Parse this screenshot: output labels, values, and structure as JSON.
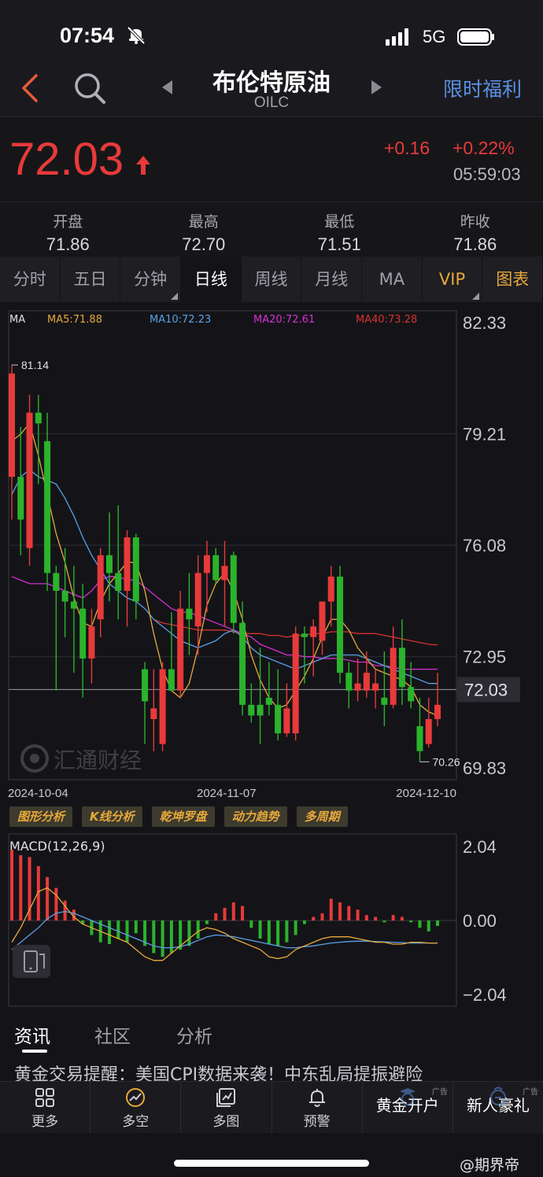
{
  "status": {
    "time": "07:54",
    "network": "5G"
  },
  "header": {
    "title": "布伦特原油",
    "code": "OILC",
    "promo": "限时福利"
  },
  "quote": {
    "price": "72.03",
    "change_abs": "+0.16",
    "change_pct": "+0.22%",
    "time": "05:59:03"
  },
  "stats": [
    {
      "label": "开盘",
      "value": "71.86"
    },
    {
      "label": "最高",
      "value": "72.70"
    },
    {
      "label": "最低",
      "value": "71.51"
    },
    {
      "label": "昨收",
      "value": "71.86"
    }
  ],
  "tabs": [
    "分时",
    "五日",
    "分钟",
    "日线",
    "周线",
    "月线",
    "MA",
    "VIP",
    "图表"
  ],
  "active_tab": "日线",
  "colors": {
    "up": "#e83a3a",
    "down": "#2bb32b",
    "ma5": "#e7a93a",
    "ma10": "#5aa0e6",
    "ma20": "#d62fd6",
    "ma40": "#d83030"
  },
  "chart_data": [
    {
      "type": "candlestick",
      "indicator": "MA",
      "legend": {
        "label": "MA",
        "ma5": "MA5:71.88",
        "ma10": "MA10:72.23",
        "ma20": "MA20:72.61",
        "ma40": "MA40:73.28"
      },
      "y_ticks": [
        "82.33",
        "79.21",
        "76.08",
        "72.95",
        "69.83"
      ],
      "ylim": [
        69.83,
        82.33
      ],
      "last_price_label": "72.03",
      "high_label": "81.14",
      "low_label": "70.26",
      "x_labels": [
        "2024-10-04",
        "2024-11-07",
        "2024-12-10"
      ],
      "candles": [
        [
          78.0,
          81.14,
          76.8,
          80.9
        ],
        [
          78.0,
          79.4,
          75.8,
          76.8
        ],
        [
          76.0,
          80.3,
          75.5,
          79.8
        ],
        [
          79.8,
          80.3,
          77.8,
          79.5
        ],
        [
          79.0,
          79.8,
          74.8,
          75.3
        ],
        [
          75.3,
          75.5,
          72.0,
          74.8
        ],
        [
          74.8,
          76.0,
          73.5,
          74.5
        ],
        [
          74.5,
          75.5,
          72.5,
          74.3
        ],
        [
          74.3,
          75.0,
          71.8,
          72.9
        ],
        [
          72.9,
          74.3,
          72.2,
          73.8
        ],
        [
          74.0,
          76.0,
          73.5,
          75.8
        ],
        [
          75.8,
          77.0,
          74.5,
          75.3
        ],
        [
          75.3,
          77.2,
          74.0,
          74.8
        ],
        [
          74.8,
          76.5,
          73.8,
          76.3
        ],
        [
          76.3,
          76.4,
          74.0,
          74.5
        ],
        [
          72.6,
          72.8,
          70.5,
          71.7
        ],
        [
          71.2,
          72.6,
          70.3,
          71.5
        ],
        [
          70.5,
          72.8,
          70.3,
          72.6
        ],
        [
          72.6,
          74.2,
          72.2,
          72.0
        ],
        [
          72.0,
          74.8,
          71.8,
          74.3
        ],
        [
          74.3,
          75.3,
          73.0,
          74.0
        ],
        [
          73.8,
          75.8,
          73.0,
          75.3
        ],
        [
          75.3,
          76.2,
          74.2,
          75.8
        ],
        [
          75.8,
          76.0,
          75.0,
          75.1
        ],
        [
          75.1,
          76.2,
          73.8,
          75.5
        ],
        [
          75.8,
          75.9,
          73.6,
          73.9
        ],
        [
          73.9,
          74.5,
          71.3,
          71.6
        ],
        [
          71.6,
          72.2,
          71.1,
          71.3
        ],
        [
          71.6,
          73.2,
          70.5,
          71.3
        ],
        [
          71.8,
          72.8,
          71.3,
          71.6
        ],
        [
          71.6,
          72.6,
          70.6,
          70.8
        ],
        [
          70.8,
          72.2,
          70.7,
          71.5
        ],
        [
          70.8,
          73.8,
          70.6,
          73.6
        ],
        [
          73.6,
          73.8,
          72.2,
          73.5
        ],
        [
          73.5,
          74.0,
          72.4,
          73.8
        ],
        [
          73.4,
          74.5,
          73.0,
          74.5
        ],
        [
          74.5,
          75.5,
          73.8,
          75.2
        ],
        [
          75.2,
          75.5,
          72.2,
          72.5
        ],
        [
          72.5,
          72.8,
          71.5,
          72.0
        ],
        [
          72.0,
          72.9,
          71.7,
          72.2
        ],
        [
          72.0,
          73.1,
          71.8,
          72.5
        ],
        [
          72.0,
          72.6,
          71.5,
          72.2
        ],
        [
          71.8,
          73.1,
          71.0,
          71.6
        ],
        [
          71.6,
          73.8,
          71.5,
          73.2
        ],
        [
          73.2,
          74.0,
          71.6,
          72.1
        ],
        [
          72.1,
          72.8,
          71.5,
          71.7
        ],
        [
          71.0,
          71.8,
          70.0,
          70.3
        ],
        [
          70.5,
          71.8,
          70.4,
          71.2
        ],
        [
          71.2,
          72.5,
          71.0,
          71.6
        ]
      ],
      "ma5": [
        79.0,
        79.2,
        79.5,
        78.6,
        77.5,
        76.4,
        75.6,
        74.6,
        73.9,
        73.8,
        74.5,
        75.0,
        75.3,
        75.6,
        75.6,
        74.8,
        73.6,
        72.6,
        72.0,
        71.8,
        72.2,
        73.2,
        74.4,
        75.0,
        75.3,
        74.8,
        74.0,
        73.0,
        72.3,
        71.8,
        71.5,
        71.6,
        72.0,
        72.4,
        72.9,
        73.5,
        74.0,
        74.0,
        73.7,
        73.2,
        72.9,
        72.6,
        72.5,
        72.4,
        72.3,
        72.1,
        71.6,
        71.4,
        71.3
      ],
      "ma10": [
        77.5,
        78.0,
        78.2,
        78.0,
        77.9,
        77.8,
        77.4,
        76.9,
        76.3,
        75.8,
        75.4,
        75.0,
        74.8,
        74.6,
        74.5,
        74.3,
        74.0,
        73.8,
        73.6,
        73.4,
        73.3,
        73.2,
        73.3,
        73.4,
        73.6,
        73.7,
        73.5,
        73.2,
        73.0,
        72.9,
        72.8,
        72.7,
        72.6,
        72.7,
        72.8,
        72.9,
        73.0,
        73.0,
        73.0,
        73.0,
        72.9,
        72.8,
        72.7,
        72.6,
        72.5,
        72.4,
        72.3,
        72.2,
        72.2
      ],
      "ma20": [
        75.2,
        75.1,
        75.0,
        75.0,
        75.0,
        74.9,
        74.8,
        74.7,
        74.6,
        74.8,
        75.1,
        75.2,
        75.2,
        75.1,
        75.1,
        74.9,
        74.7,
        74.5,
        74.3,
        74.2,
        74.2,
        74.1,
        74.0,
        73.9,
        73.8,
        73.7,
        73.6,
        73.5,
        73.3,
        73.2,
        73.1,
        73.0,
        73.0,
        72.95,
        72.95,
        72.9,
        72.9,
        72.9,
        72.85,
        72.8,
        72.8,
        72.7,
        72.7,
        72.65,
        72.6,
        72.6,
        72.6,
        72.6,
        72.6
      ],
      "ma40": [
        null,
        null,
        null,
        null,
        null,
        null,
        null,
        null,
        null,
        null,
        null,
        null,
        null,
        null,
        null,
        null,
        74.0,
        73.9,
        73.85,
        73.8,
        73.75,
        73.7,
        73.7,
        73.7,
        73.7,
        73.65,
        73.6,
        73.6,
        73.6,
        73.55,
        73.55,
        73.5,
        73.55,
        73.55,
        73.6,
        73.6,
        73.65,
        73.65,
        73.65,
        73.6,
        73.6,
        73.6,
        73.55,
        73.5,
        73.45,
        73.4,
        73.35,
        73.3,
        73.28
      ]
    },
    {
      "type": "bar",
      "indicator": "MACD",
      "title": "MACD(12,26,9)",
      "y_ticks": [
        "2.04",
        "0.00",
        "−2.04"
      ],
      "ylim": [
        -2.04,
        2.04
      ],
      "histogram": [
        1.95,
        1.8,
        1.75,
        1.5,
        1.2,
        0.9,
        0.55,
        0.3,
        -0.1,
        -0.4,
        -0.6,
        -0.65,
        -0.5,
        -0.6,
        -0.35,
        -0.7,
        -0.9,
        -1.0,
        -0.9,
        -0.8,
        -0.7,
        -0.5,
        -0.1,
        0.2,
        0.35,
        0.5,
        0.4,
        -0.2,
        -0.5,
        -0.65,
        -0.7,
        -0.6,
        -0.4,
        -0.1,
        0.1,
        0.2,
        0.6,
        0.5,
        0.4,
        0.3,
        0.15,
        0.1,
        -0.05,
        0.15,
        0.1,
        -0.05,
        -0.2,
        -0.3,
        -0.15
      ],
      "dif": [
        -0.6,
        -0.2,
        0.3,
        0.8,
        0.9,
        0.7,
        0.4,
        0.1,
        -0.1,
        -0.2,
        -0.3,
        -0.4,
        -0.5,
        -0.6,
        -0.8,
        -1.0,
        -1.1,
        -1.1,
        -0.9,
        -0.7,
        -0.5,
        -0.3,
        -0.2,
        -0.25,
        -0.35,
        -0.5,
        -0.6,
        -0.7,
        -0.8,
        -1.0,
        -1.05,
        -1.0,
        -0.8,
        -0.7,
        -0.6,
        -0.5,
        -0.45,
        -0.45,
        -0.45,
        -0.5,
        -0.55,
        -0.6,
        -0.6,
        -0.65,
        -0.65,
        -0.6,
        -0.6,
        -0.62,
        -0.62
      ],
      "dea": [
        -0.8,
        -0.6,
        -0.4,
        -0.2,
        0.05,
        0.2,
        0.25,
        0.2,
        0.1,
        0.0,
        -0.1,
        -0.2,
        -0.3,
        -0.4,
        -0.5,
        -0.6,
        -0.7,
        -0.75,
        -0.75,
        -0.72,
        -0.65,
        -0.55,
        -0.45,
        -0.4,
        -0.42,
        -0.45,
        -0.5,
        -0.55,
        -0.6,
        -0.65,
        -0.7,
        -0.75,
        -0.75,
        -0.72,
        -0.7,
        -0.66,
        -0.62,
        -0.6,
        -0.58,
        -0.57,
        -0.57,
        -0.58,
        -0.59,
        -0.6,
        -0.61,
        -0.62,
        -0.62,
        -0.62,
        -0.62
      ]
    }
  ],
  "watermark_brand": "汇通财经",
  "tool_buttons": [
    "图形分析",
    "K线分析",
    "乾坤罗盘",
    "动力趋势",
    "多周期"
  ],
  "news_tabs": [
    "资讯",
    "社区",
    "分析"
  ],
  "news_headline": "黄金交易提醒：美国CPI数据来袭！中东乱局提振避险",
  "bottom_nav": [
    {
      "label": "更多",
      "icon": "grid-icon"
    },
    {
      "label": "多空",
      "icon": "bull-bear-icon"
    },
    {
      "label": "多图",
      "icon": "multi-chart-icon"
    },
    {
      "label": "预警",
      "icon": "bell-icon"
    },
    {
      "label": "黄金开户",
      "icon": "account-icon",
      "ad": "广告"
    },
    {
      "label": "新人豪礼",
      "icon": "gift-icon",
      "ad": "广告"
    }
  ],
  "footer_watermark": "@期界帝"
}
